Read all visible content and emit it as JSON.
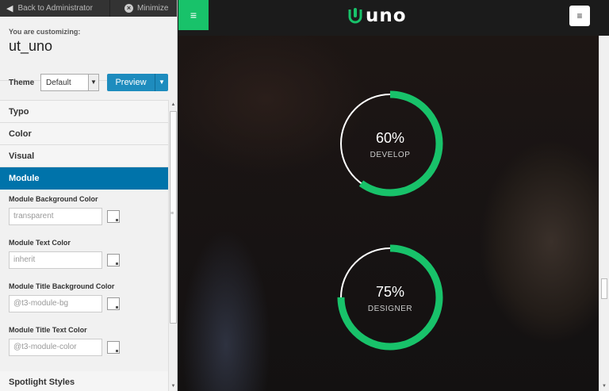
{
  "topbar": {
    "back_label": "Back to Administrator",
    "minimize_label": "Minimize"
  },
  "customizer": {
    "label": "You are customizing:",
    "name": "ut_uno"
  },
  "theme": {
    "label": "Theme",
    "selected": "Default",
    "preview_label": "Preview"
  },
  "sections": {
    "typo": "Typo",
    "color": "Color",
    "visual": "Visual",
    "module": "Module",
    "spotlight": "Spotlight Styles"
  },
  "module_controls": [
    {
      "label": "Module Background Color",
      "value": "transparent"
    },
    {
      "label": "Module Text Color",
      "value": "inherit"
    },
    {
      "label": "Module Title Background Color",
      "value": "@t3-module-bg"
    },
    {
      "label": "Module Title Text Color",
      "value": "@t3-module-color"
    }
  ],
  "site": {
    "logo_text": "uno",
    "accent_color": "#18c26a"
  },
  "skills": [
    {
      "percent_text": "60%",
      "fraction": 0.6,
      "label": "DEVELOP"
    },
    {
      "percent_text": "75%",
      "fraction": 0.75,
      "label": "DESIGNER"
    }
  ]
}
